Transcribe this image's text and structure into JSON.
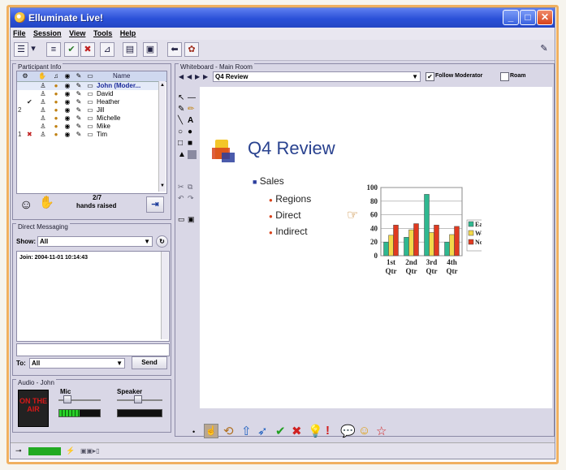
{
  "window": {
    "title": "Elluminate Live!"
  },
  "menu": [
    "File",
    "Session",
    "View",
    "Tools",
    "Help"
  ],
  "participants": {
    "panel_title": "Participant Info",
    "name_header": "Name",
    "rows": [
      {
        "num": "",
        "name": "John (Moder...",
        "mark": ""
      },
      {
        "num": "",
        "name": "David",
        "mark": ""
      },
      {
        "num": "",
        "name": "Heather",
        "mark": "check"
      },
      {
        "num": "2",
        "name": "Jill",
        "mark": ""
      },
      {
        "num": "",
        "name": "Michelle",
        "mark": ""
      },
      {
        "num": "",
        "name": "Mike",
        "mark": ""
      },
      {
        "num": "1",
        "name": "Tim",
        "mark": "x"
      }
    ],
    "hands_count": "2/7",
    "hands_label": "hands raised"
  },
  "direct_messaging": {
    "panel_title": "Direct Messaging",
    "show_label": "Show:",
    "show_value": "All",
    "join_message": "Join: 2004-11-01 10:14:43",
    "to_label": "To:",
    "to_value": "All",
    "send_label": "Send"
  },
  "audio": {
    "panel_title": "Audio - John",
    "on_air": "ON THE AIR",
    "mic_label": "Mic",
    "speaker_label": "Speaker",
    "mic_level": 0.5,
    "mic_slider": 0.15,
    "speaker_slider": 0.45
  },
  "whiteboard": {
    "panel_title": "Whiteboard - Main Room",
    "page_select": "Q4 Review",
    "follow_moderator": "Follow Moderator",
    "follow_checked": true,
    "roam": "Roam",
    "slide_title": "Q4 Review",
    "bullet_main": "Sales",
    "sub_bullets": [
      "Regions",
      "Direct",
      "Indirect"
    ]
  },
  "chart_data": {
    "type": "bar",
    "categories": [
      "1st Qtr",
      "2nd Qtr",
      "3rd Qtr",
      "4th Qtr"
    ],
    "series": [
      {
        "name": "East",
        "values": [
          20,
          27,
          90,
          20
        ],
        "color": "#2fb890"
      },
      {
        "name": "West",
        "values": [
          30,
          38,
          34,
          31
        ],
        "color": "#f3d84a"
      },
      {
        "name": "North",
        "values": [
          45,
          47,
          45,
          43
        ],
        "color": "#e03a20"
      }
    ],
    "ylim": [
      0,
      100
    ],
    "yticks": [
      0,
      20,
      40,
      60,
      80,
      100
    ],
    "grid": true,
    "legend": "right"
  },
  "colors": {
    "accent": "#2a50d8",
    "status_green": "#22aa22"
  }
}
